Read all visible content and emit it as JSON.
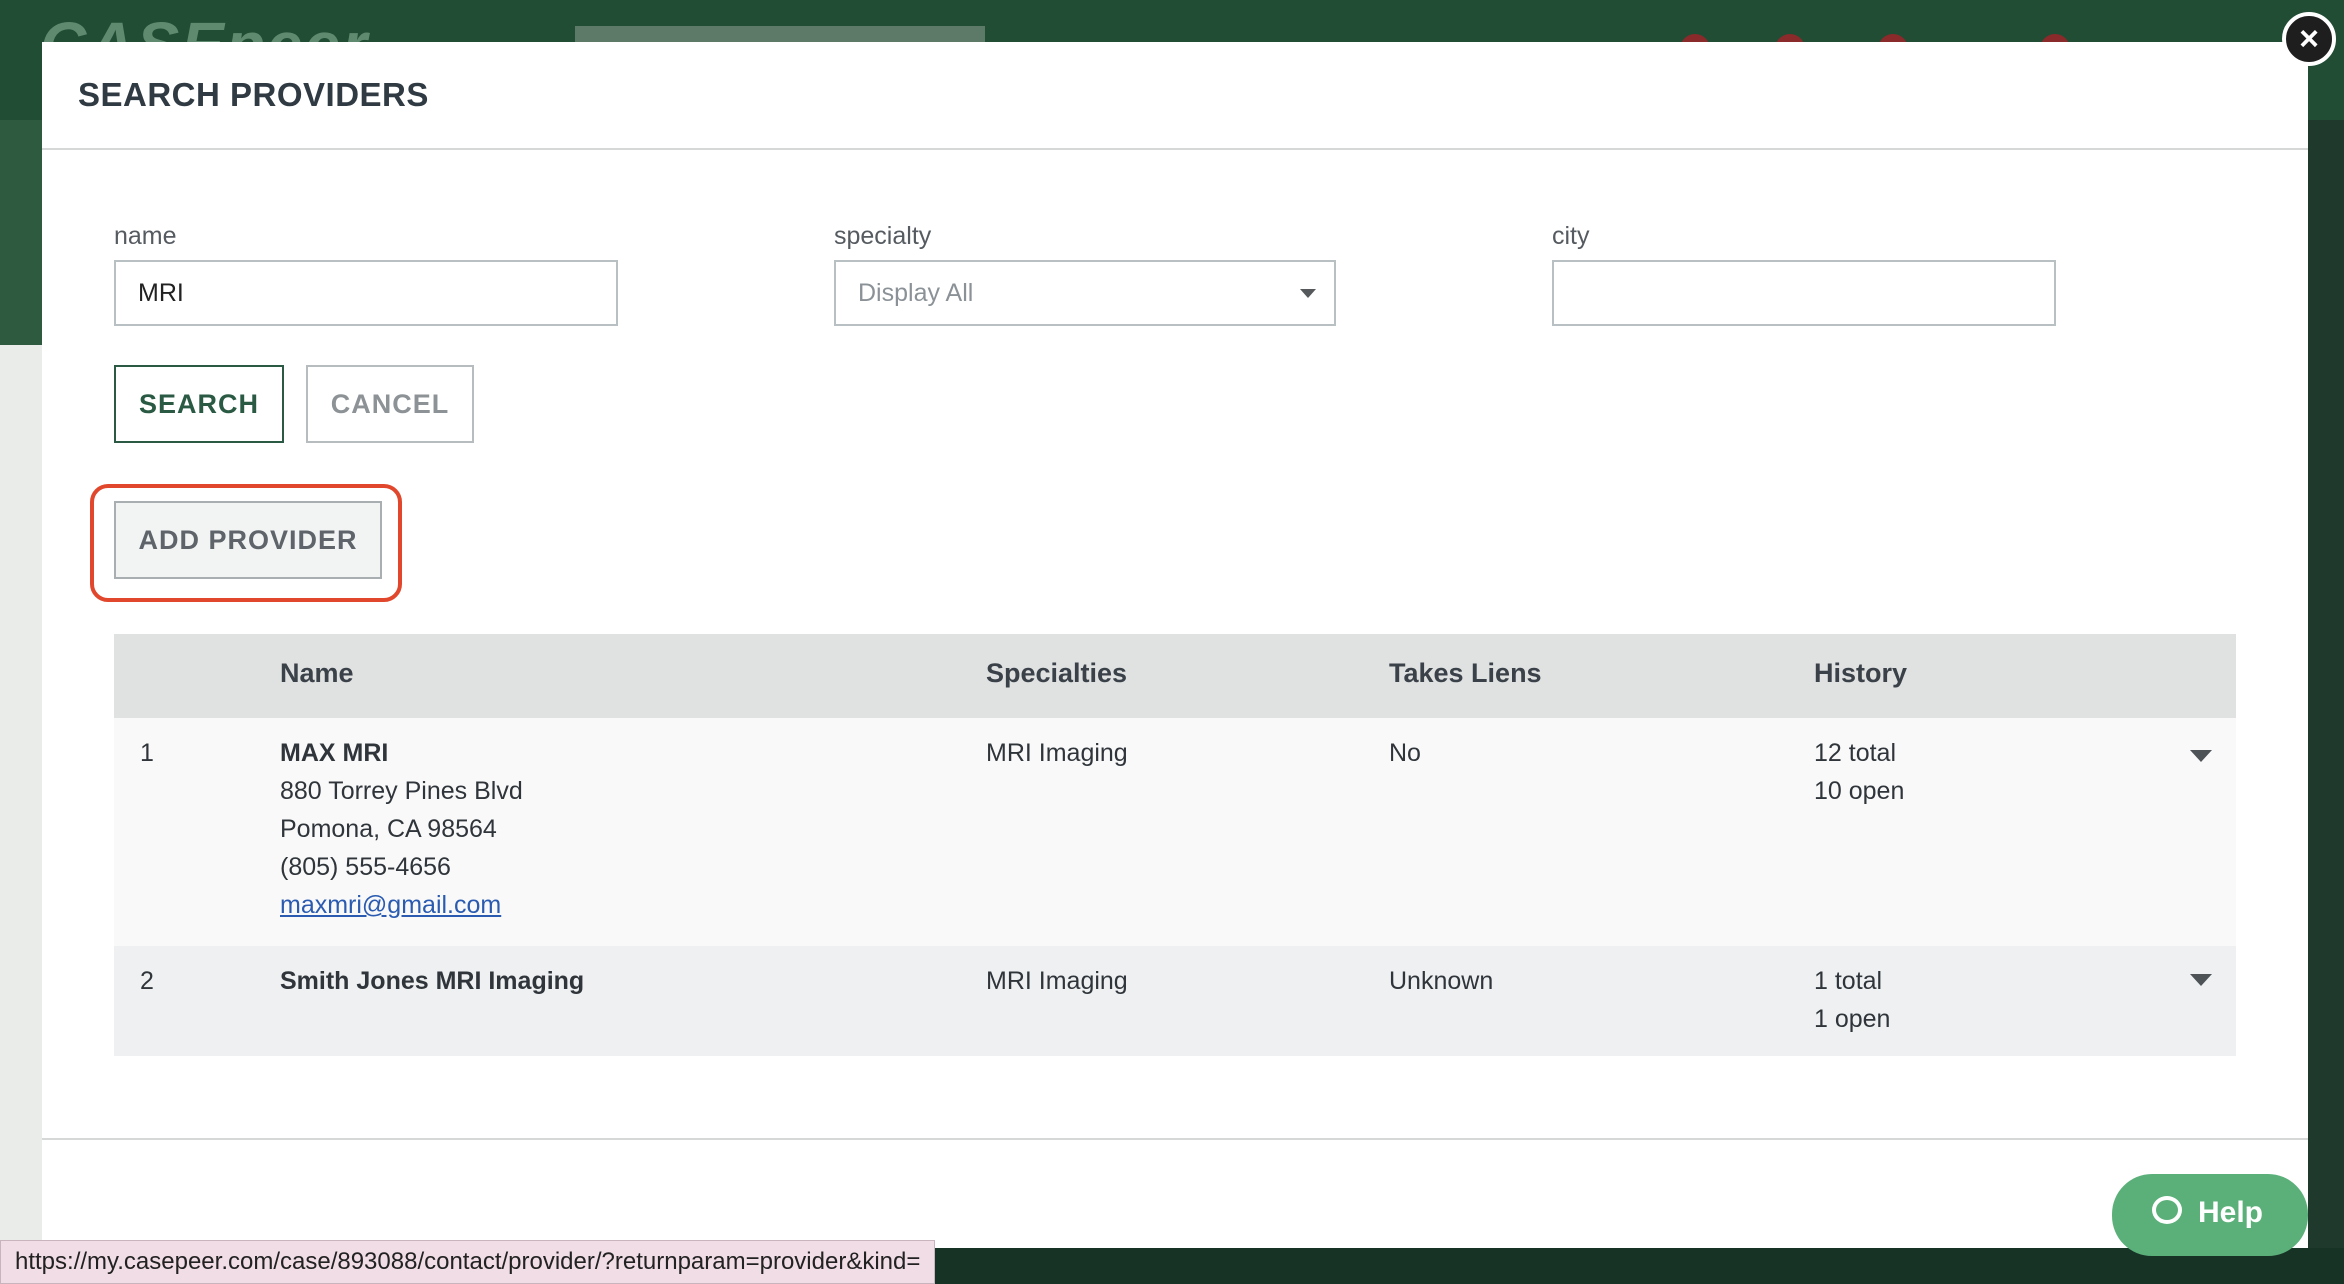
{
  "background": {
    "logo_text": "CASEpeer"
  },
  "modal": {
    "title": "SEARCH PROVIDERS",
    "close_icon": "×",
    "fields": {
      "name": {
        "label": "name",
        "value": "MRI"
      },
      "specialty": {
        "label": "specialty",
        "value": "Display All"
      },
      "city": {
        "label": "city",
        "value": ""
      }
    },
    "buttons": {
      "search": "SEARCH",
      "cancel": "CANCEL",
      "add_provider": "ADD PROVIDER"
    },
    "table": {
      "headers": [
        "",
        "Name",
        "Specialties",
        "Takes Liens",
        "History"
      ],
      "rows": [
        {
          "index": "1",
          "name": "MAX MRI",
          "address1": "880 Torrey Pines Blvd",
          "address2": "Pomona, CA 98564",
          "phone": "(805) 555-4656",
          "email": "maxmri@gmail.com",
          "specialties": "MRI Imaging",
          "takes_liens": "No",
          "history_total": "12 total",
          "history_open": "10 open"
        },
        {
          "index": "2",
          "name": "Smith Jones MRI Imaging",
          "specialties": "MRI Imaging",
          "takes_liens": "Unknown",
          "history_total": "1 total",
          "history_open": "1 open"
        }
      ]
    }
  },
  "help": {
    "label": "Help"
  },
  "status_bar": {
    "url": "https://my.casepeer.com/case/893088/contact/provider/?returnparam=provider&kind="
  },
  "colors": {
    "accent_green": "#2a5a43",
    "highlight_red": "#e1472c",
    "help_green": "#5bb07a"
  }
}
